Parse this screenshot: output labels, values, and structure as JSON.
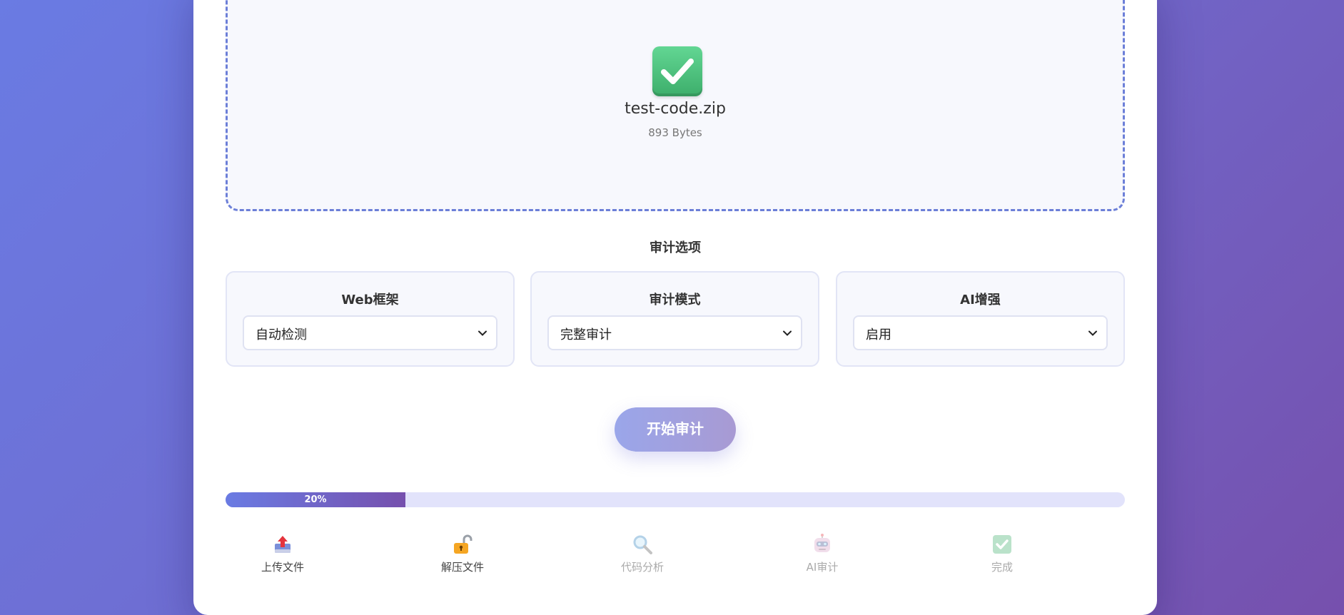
{
  "upload": {
    "file_name": "test-code.zip",
    "file_size": "893 Bytes"
  },
  "options": {
    "title": "审计选项",
    "framework": {
      "label": "Web框架",
      "value": "自动检测"
    },
    "mode": {
      "label": "审计模式",
      "value": "完整审计"
    },
    "ai": {
      "label": "AI增强",
      "value": "启用"
    }
  },
  "start_button": {
    "label": "开始审计"
  },
  "progress": {
    "percent": 20,
    "label": "20%"
  },
  "steps": [
    {
      "label": "上传文件",
      "icon": "upload-icon",
      "status": "done"
    },
    {
      "label": "解压文件",
      "icon": "unlock-icon",
      "status": "done"
    },
    {
      "label": "代码分析",
      "icon": "magnifier-icon",
      "status": "pending"
    },
    {
      "label": "AI审计",
      "icon": "robot-icon",
      "status": "pending"
    },
    {
      "label": "完成",
      "icon": "check-icon",
      "status": "pending"
    }
  ],
  "colors": {
    "accent_start": "#6a7be3",
    "accent_end": "#7650ad",
    "success": "#3dae6b"
  }
}
